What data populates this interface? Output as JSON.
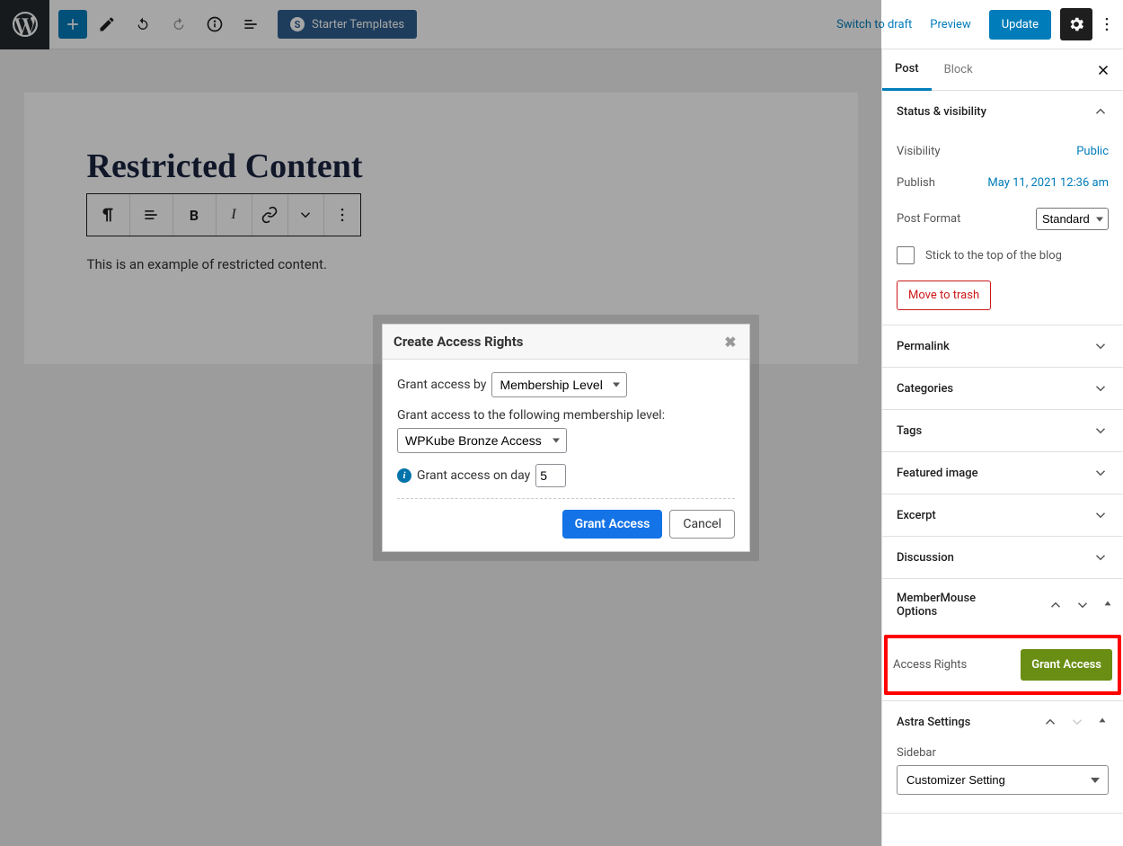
{
  "toolbar": {
    "starter_label": "Starter Templates",
    "switch_draft": "Switch to draft",
    "preview": "Preview",
    "update": "Update"
  },
  "editor": {
    "title": "Restricted Content",
    "paragraph": "This is an example of restricted content."
  },
  "sidebar": {
    "tabs": {
      "post": "Post",
      "block": "Block"
    },
    "status": {
      "title": "Status & visibility",
      "visibility_label": "Visibility",
      "visibility_value": "Public",
      "publish_label": "Publish",
      "publish_value": "May 11, 2021 12:36 am",
      "format_label": "Post Format",
      "format_value": "Standard",
      "stick_label": "Stick to the top of the blog",
      "trash": "Move to trash"
    },
    "panels": {
      "permalink": "Permalink",
      "categories": "Categories",
      "tags": "Tags",
      "featured": "Featured image",
      "excerpt": "Excerpt",
      "discussion": "Discussion",
      "membermouse": "MemberMouse Options",
      "astra": "Astra Settings"
    },
    "access": {
      "label": "Access Rights",
      "button": "Grant Access"
    },
    "astra": {
      "sidebar_label": "Sidebar",
      "sidebar_value": "Customizer Setting"
    }
  },
  "modal": {
    "title": "Create Access Rights",
    "grant_by_label": "Grant access by",
    "grant_by_value": "Membership Level",
    "grant_to_label": "Grant access to the following membership level:",
    "level_value": "WPKube Bronze Access",
    "day_label": "Grant access on day",
    "day_value": "5",
    "grant_button": "Grant Access",
    "cancel_button": "Cancel"
  }
}
